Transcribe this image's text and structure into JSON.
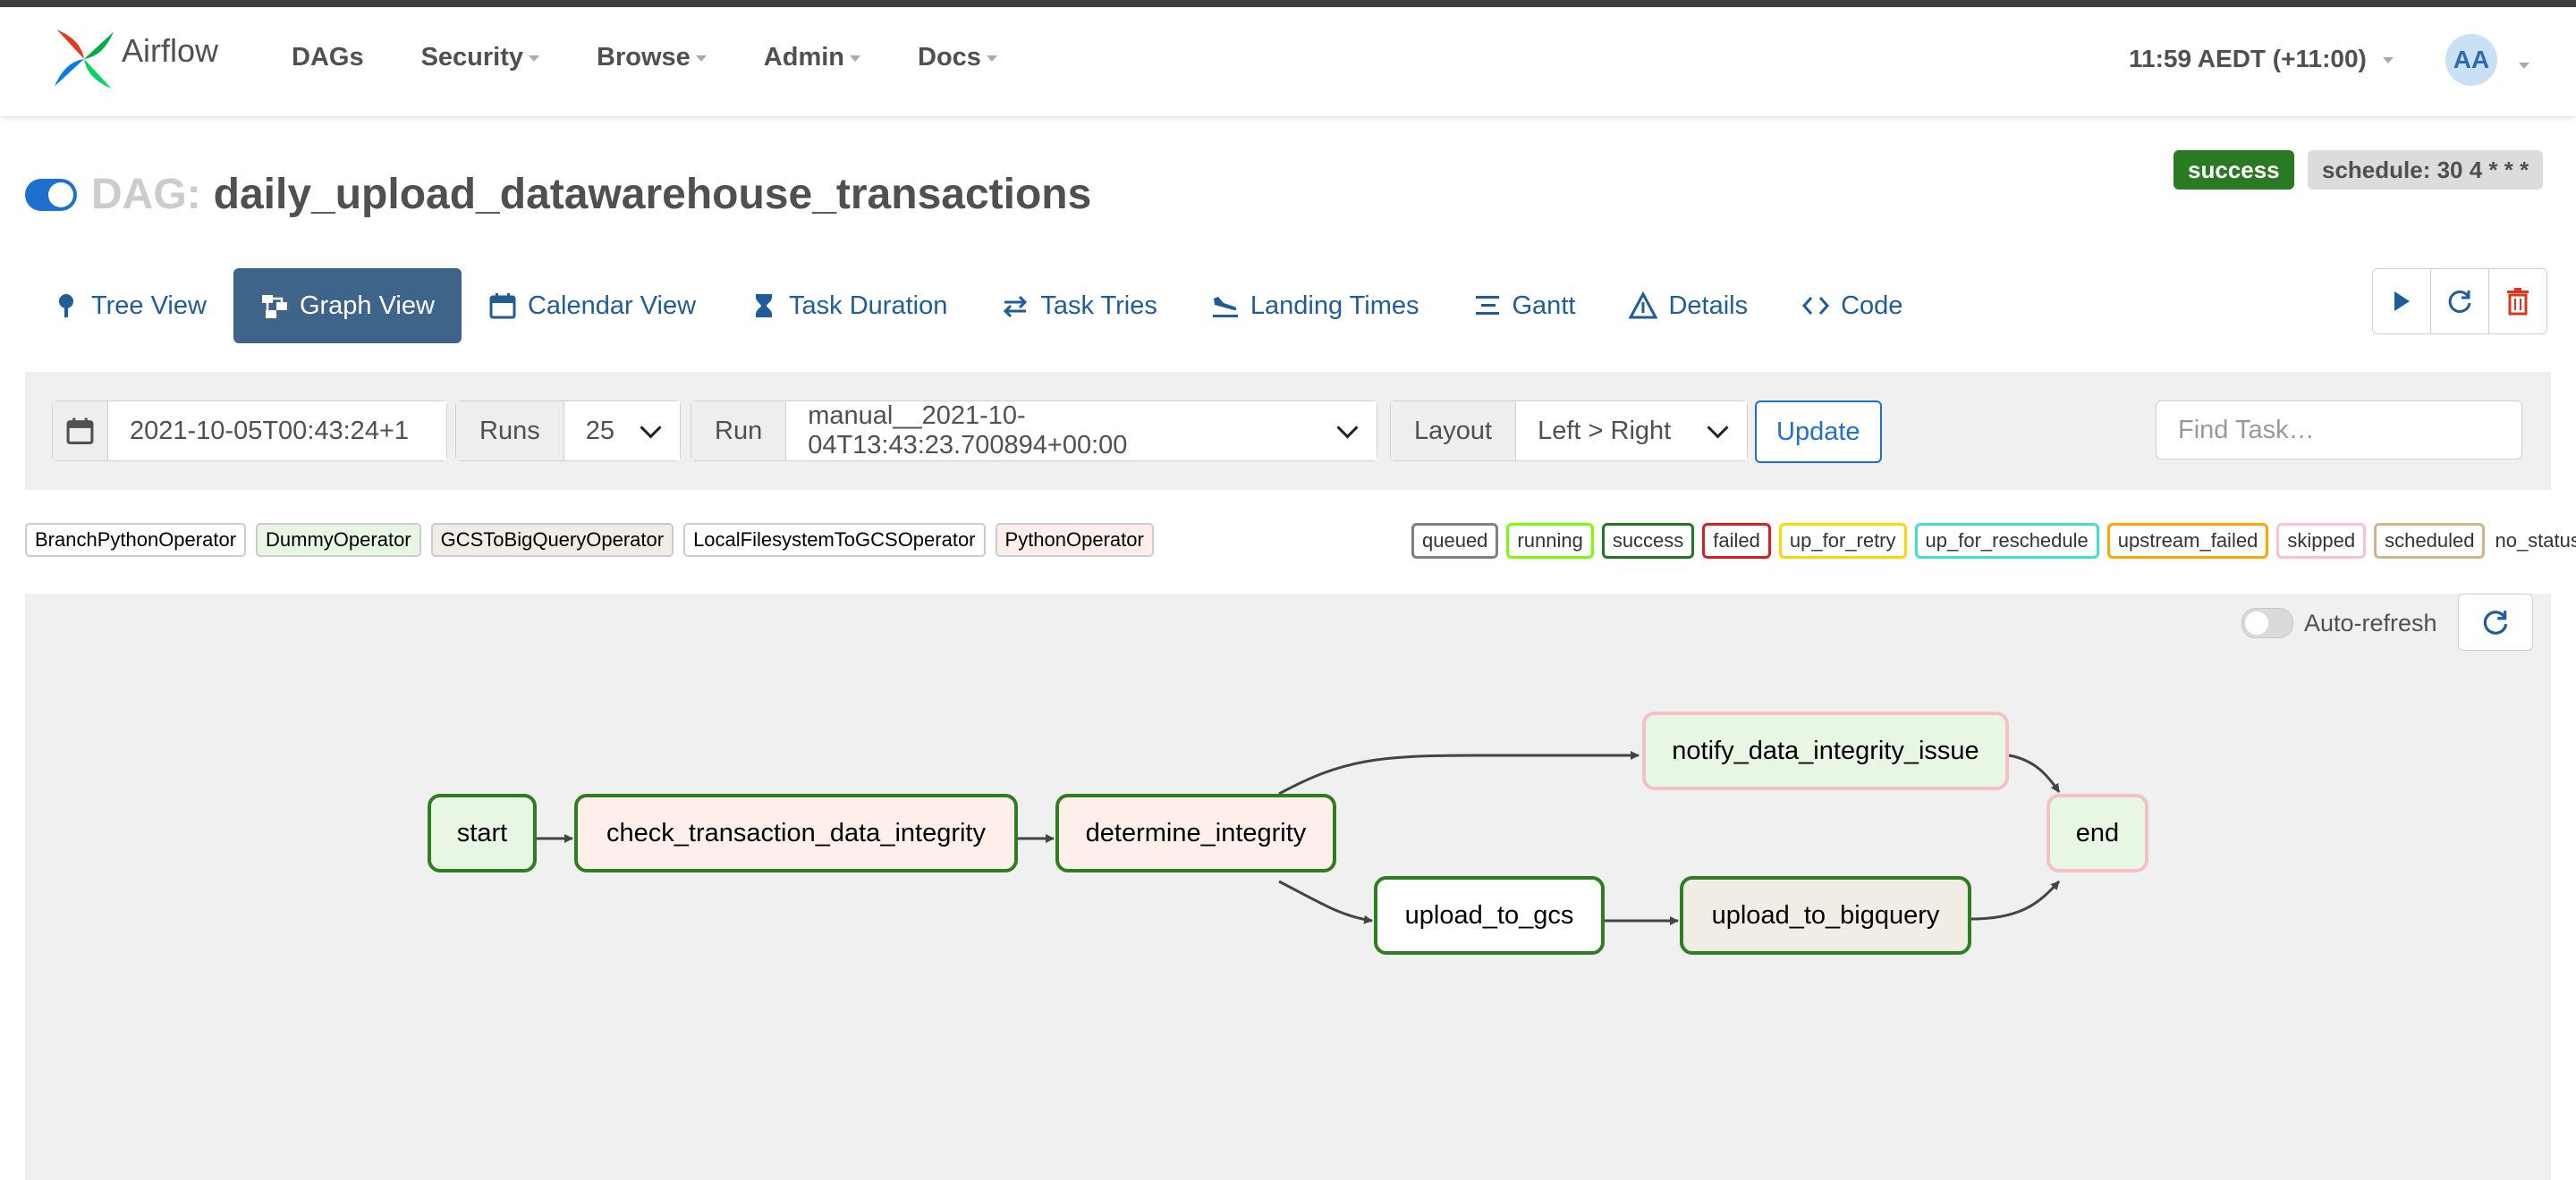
{
  "navbar": {
    "brand": "Airflow",
    "items": [
      {
        "label": "DAGs",
        "dropdown": false
      },
      {
        "label": "Security",
        "dropdown": true
      },
      {
        "label": "Browse",
        "dropdown": true
      },
      {
        "label": "Admin",
        "dropdown": true
      },
      {
        "label": "Docs",
        "dropdown": true
      }
    ],
    "clock": "11:59 AEDT (+11:00)",
    "avatar": "AA"
  },
  "dag": {
    "prefix": "DAG:",
    "id": "daily_upload_datawarehouse_transactions",
    "paused": false,
    "status": "success",
    "schedule": "schedule: 30 4 * * *"
  },
  "tabs": [
    {
      "label": "Tree View",
      "icon": "tree-icon"
    },
    {
      "label": "Graph View",
      "icon": "graph-icon",
      "active": true
    },
    {
      "label": "Calendar View",
      "icon": "calendar-icon"
    },
    {
      "label": "Task Duration",
      "icon": "hourglass-icon"
    },
    {
      "label": "Task Tries",
      "icon": "retry-arrows-icon"
    },
    {
      "label": "Landing Times",
      "icon": "plane-landing-icon"
    },
    {
      "label": "Gantt",
      "icon": "gantt-icon"
    },
    {
      "label": "Details",
      "icon": "warning-triangle-icon"
    },
    {
      "label": "Code",
      "icon": "code-brackets-icon"
    }
  ],
  "filters": {
    "base_date": "2021-10-05T00:43:24+1",
    "runs_label": "Runs",
    "runs_value": "25",
    "run_label": "Run",
    "run_value": "manual__2021-10-04T13:43:23.700894+00:00",
    "layout_label": "Layout",
    "layout_value": "Left > Right",
    "update": "Update",
    "find_placeholder": "Find Task…"
  },
  "operators": [
    {
      "name": "BranchPythonOperator",
      "color": "#ffffff"
    },
    {
      "name": "DummyOperator",
      "color": "#e8f7e4"
    },
    {
      "name": "GCSToBigQueryOperator",
      "color": "#f0ede4"
    },
    {
      "name": "LocalFilesystemToGCSOperator",
      "color": "#ffffff"
    },
    {
      "name": "PythonOperator",
      "color": "#ffefeb"
    }
  ],
  "states": [
    {
      "name": "queued",
      "color": "#808080"
    },
    {
      "name": "running",
      "color": "#7cfc00"
    },
    {
      "name": "success",
      "color": "#1e7a1e"
    },
    {
      "name": "failed",
      "color": "#e01b1b"
    },
    {
      "name": "up_for_retry",
      "color": "#ffd700"
    },
    {
      "name": "up_for_reschedule",
      "color": "#40e0d0"
    },
    {
      "name": "upstream_failed",
      "color": "#ffa500"
    },
    {
      "name": "skipped",
      "color": "#ffc0cb"
    },
    {
      "name": "scheduled",
      "color": "#d2b48c"
    },
    {
      "name": "no_status",
      "color": ""
    }
  ],
  "graph": {
    "auto_refresh": "Auto-refresh",
    "tasks": {
      "start": {
        "label": "start",
        "state": "success",
        "fill": "#e8f7e4",
        "border": "#2e7d21"
      },
      "check": {
        "label": "check_transaction_data_integrity",
        "state": "success",
        "fill": "#ffefeb",
        "border": "#2e7d21"
      },
      "determine": {
        "label": "determine_integrity",
        "state": "success",
        "fill": "#ffefeb",
        "border": "#2e7d21"
      },
      "notify": {
        "label": "notify_data_integrity_issue",
        "state": "skipped",
        "fill": "#e8f7e4",
        "border": "#f5c0c5"
      },
      "gcs": {
        "label": "upload_to_gcs",
        "state": "success",
        "fill": "#ffffff",
        "border": "#2e7d21"
      },
      "bq": {
        "label": "upload_to_bigquery",
        "state": "success",
        "fill": "#f0ede4",
        "border": "#2e7d21"
      },
      "end": {
        "label": "end",
        "state": "skipped",
        "fill": "#e8f7e4",
        "border": "#f5c0c5"
      }
    }
  }
}
